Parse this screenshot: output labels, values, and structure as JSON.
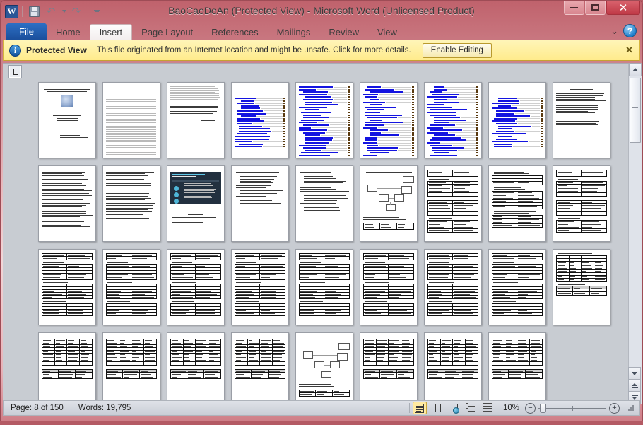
{
  "window": {
    "title": "BaoCaoDoAn (Protected View)  -  Microsoft Word (Unlicensed Product)",
    "app_logo_letter": "W",
    "accent_color": "#b45a64",
    "controls": {
      "minimize": "minimize-button",
      "maximize": "maximize-button",
      "close_label": "✕"
    }
  },
  "quick_access": {
    "items": [
      {
        "name": "save-icon",
        "label": "Save"
      },
      {
        "name": "undo-icon",
        "label": "Undo"
      },
      {
        "name": "redo-icon",
        "label": "Redo"
      },
      {
        "name": "customize-qat-icon",
        "label": "Customize Quick Access Toolbar"
      }
    ]
  },
  "ribbon": {
    "tabs": [
      {
        "label": "File",
        "state": "file"
      },
      {
        "label": "Home",
        "state": "normal"
      },
      {
        "label": "Insert",
        "state": "hovered"
      },
      {
        "label": "Page Layout",
        "state": "normal"
      },
      {
        "label": "References",
        "state": "normal"
      },
      {
        "label": "Mailings",
        "state": "normal"
      },
      {
        "label": "Review",
        "state": "normal"
      },
      {
        "label": "View",
        "state": "normal"
      }
    ],
    "collapse_icon": "⌄",
    "help_label": "?"
  },
  "protected_view": {
    "info_icon": "i",
    "title": "Protected View",
    "message": "This file originated from an Internet location and might be unsafe. Click for more details.",
    "enable_button": "Enable Editing",
    "close_label": "✕",
    "background": "#ffeb8c"
  },
  "document": {
    "tab_selector_icon": "left-tab-stop-icon",
    "columns": 9,
    "pages": [
      {
        "n": 1,
        "layout": "title"
      },
      {
        "n": 2,
        "layout": "dense-gray"
      },
      {
        "n": 3,
        "layout": "text-mixed"
      },
      {
        "n": 4,
        "layout": "toc-short"
      },
      {
        "n": 5,
        "layout": "toc"
      },
      {
        "n": 6,
        "layout": "toc"
      },
      {
        "n": 7,
        "layout": "toc"
      },
      {
        "n": 8,
        "layout": "toc-short"
      },
      {
        "n": 9,
        "layout": "text-sparse"
      },
      {
        "n": 10,
        "layout": "text-body"
      },
      {
        "n": 11,
        "layout": "text-body"
      },
      {
        "n": 12,
        "layout": "screenshot"
      },
      {
        "n": 13,
        "layout": "bullets"
      },
      {
        "n": 14,
        "layout": "bullets"
      },
      {
        "n": 15,
        "layout": "diagram"
      },
      {
        "n": 16,
        "layout": "tables"
      },
      {
        "n": 17,
        "layout": "text-tables"
      },
      {
        "n": 18,
        "layout": "tables"
      },
      {
        "n": 19,
        "layout": "tables"
      },
      {
        "n": 20,
        "layout": "tables"
      },
      {
        "n": 21,
        "layout": "tables"
      },
      {
        "n": 22,
        "layout": "tables"
      },
      {
        "n": 23,
        "layout": "tables"
      },
      {
        "n": 24,
        "layout": "tables"
      },
      {
        "n": 25,
        "layout": "tables"
      },
      {
        "n": 26,
        "layout": "tables"
      },
      {
        "n": 27,
        "layout": "grid-table"
      },
      {
        "n": 28,
        "layout": "grid-table"
      },
      {
        "n": 29,
        "layout": "grid-table"
      },
      {
        "n": 30,
        "layout": "grid-table"
      },
      {
        "n": 31,
        "layout": "grid-table"
      },
      {
        "n": 32,
        "layout": "diagram"
      },
      {
        "n": 33,
        "layout": "grid-table"
      },
      {
        "n": 34,
        "layout": "grid-table"
      },
      {
        "n": 35,
        "layout": "grid-table"
      }
    ]
  },
  "scrollbar": {
    "up_arrow": "scroll-up-icon",
    "down_arrow": "scroll-down-icon",
    "previous_page": "previous-page-icon",
    "next_page": "next-page-icon"
  },
  "status_bar": {
    "page_label": "Page: 8 of 150",
    "words_label": "Words: 19,795",
    "views": [
      {
        "name": "print-layout",
        "label": "Print Layout",
        "active": true
      },
      {
        "name": "full-screen-reading",
        "label": "Full Screen Reading",
        "active": false
      },
      {
        "name": "web-layout",
        "label": "Web Layout",
        "active": false
      },
      {
        "name": "outline",
        "label": "Outline",
        "active": false
      },
      {
        "name": "draft",
        "label": "Draft",
        "active": false
      }
    ],
    "zoom_percent": "10%",
    "zoom_out_label": "−",
    "zoom_in_label": "+"
  }
}
